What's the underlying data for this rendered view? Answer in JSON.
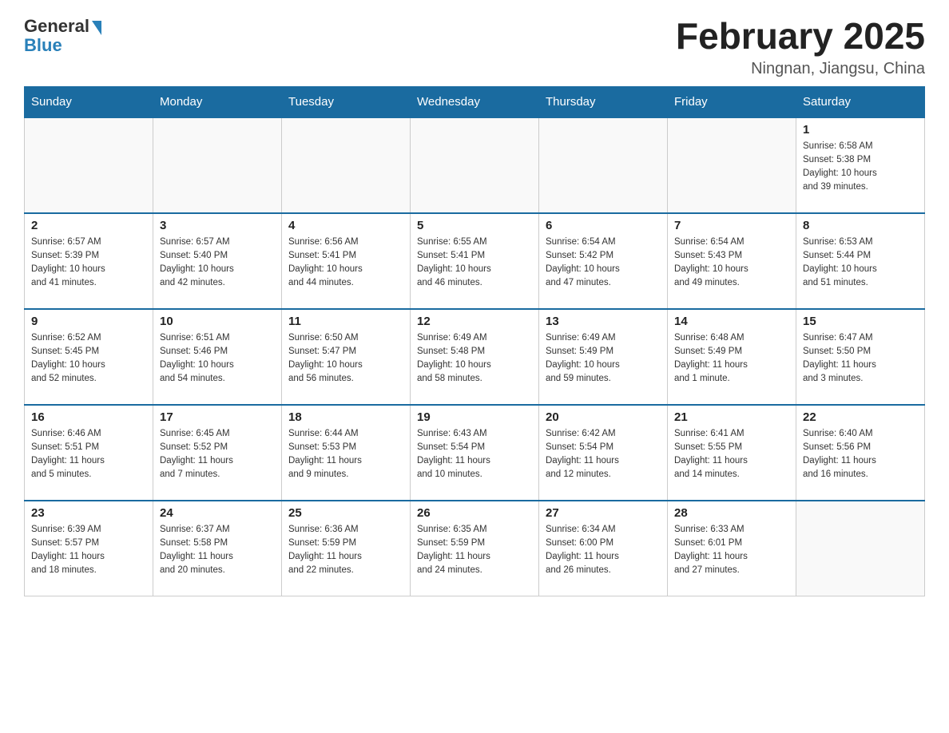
{
  "header": {
    "logo_general": "General",
    "logo_blue": "Blue",
    "month_title": "February 2025",
    "location": "Ningnan, Jiangsu, China"
  },
  "days_of_week": [
    "Sunday",
    "Monday",
    "Tuesday",
    "Wednesday",
    "Thursday",
    "Friday",
    "Saturday"
  ],
  "weeks": [
    [
      {
        "day": "",
        "info": ""
      },
      {
        "day": "",
        "info": ""
      },
      {
        "day": "",
        "info": ""
      },
      {
        "day": "",
        "info": ""
      },
      {
        "day": "",
        "info": ""
      },
      {
        "day": "",
        "info": ""
      },
      {
        "day": "1",
        "info": "Sunrise: 6:58 AM\nSunset: 5:38 PM\nDaylight: 10 hours\nand 39 minutes."
      }
    ],
    [
      {
        "day": "2",
        "info": "Sunrise: 6:57 AM\nSunset: 5:39 PM\nDaylight: 10 hours\nand 41 minutes."
      },
      {
        "day": "3",
        "info": "Sunrise: 6:57 AM\nSunset: 5:40 PM\nDaylight: 10 hours\nand 42 minutes."
      },
      {
        "day": "4",
        "info": "Sunrise: 6:56 AM\nSunset: 5:41 PM\nDaylight: 10 hours\nand 44 minutes."
      },
      {
        "day": "5",
        "info": "Sunrise: 6:55 AM\nSunset: 5:41 PM\nDaylight: 10 hours\nand 46 minutes."
      },
      {
        "day": "6",
        "info": "Sunrise: 6:54 AM\nSunset: 5:42 PM\nDaylight: 10 hours\nand 47 minutes."
      },
      {
        "day": "7",
        "info": "Sunrise: 6:54 AM\nSunset: 5:43 PM\nDaylight: 10 hours\nand 49 minutes."
      },
      {
        "day": "8",
        "info": "Sunrise: 6:53 AM\nSunset: 5:44 PM\nDaylight: 10 hours\nand 51 minutes."
      }
    ],
    [
      {
        "day": "9",
        "info": "Sunrise: 6:52 AM\nSunset: 5:45 PM\nDaylight: 10 hours\nand 52 minutes."
      },
      {
        "day": "10",
        "info": "Sunrise: 6:51 AM\nSunset: 5:46 PM\nDaylight: 10 hours\nand 54 minutes."
      },
      {
        "day": "11",
        "info": "Sunrise: 6:50 AM\nSunset: 5:47 PM\nDaylight: 10 hours\nand 56 minutes."
      },
      {
        "day": "12",
        "info": "Sunrise: 6:49 AM\nSunset: 5:48 PM\nDaylight: 10 hours\nand 58 minutes."
      },
      {
        "day": "13",
        "info": "Sunrise: 6:49 AM\nSunset: 5:49 PM\nDaylight: 10 hours\nand 59 minutes."
      },
      {
        "day": "14",
        "info": "Sunrise: 6:48 AM\nSunset: 5:49 PM\nDaylight: 11 hours\nand 1 minute."
      },
      {
        "day": "15",
        "info": "Sunrise: 6:47 AM\nSunset: 5:50 PM\nDaylight: 11 hours\nand 3 minutes."
      }
    ],
    [
      {
        "day": "16",
        "info": "Sunrise: 6:46 AM\nSunset: 5:51 PM\nDaylight: 11 hours\nand 5 minutes."
      },
      {
        "day": "17",
        "info": "Sunrise: 6:45 AM\nSunset: 5:52 PM\nDaylight: 11 hours\nand 7 minutes."
      },
      {
        "day": "18",
        "info": "Sunrise: 6:44 AM\nSunset: 5:53 PM\nDaylight: 11 hours\nand 9 minutes."
      },
      {
        "day": "19",
        "info": "Sunrise: 6:43 AM\nSunset: 5:54 PM\nDaylight: 11 hours\nand 10 minutes."
      },
      {
        "day": "20",
        "info": "Sunrise: 6:42 AM\nSunset: 5:54 PM\nDaylight: 11 hours\nand 12 minutes."
      },
      {
        "day": "21",
        "info": "Sunrise: 6:41 AM\nSunset: 5:55 PM\nDaylight: 11 hours\nand 14 minutes."
      },
      {
        "day": "22",
        "info": "Sunrise: 6:40 AM\nSunset: 5:56 PM\nDaylight: 11 hours\nand 16 minutes."
      }
    ],
    [
      {
        "day": "23",
        "info": "Sunrise: 6:39 AM\nSunset: 5:57 PM\nDaylight: 11 hours\nand 18 minutes."
      },
      {
        "day": "24",
        "info": "Sunrise: 6:37 AM\nSunset: 5:58 PM\nDaylight: 11 hours\nand 20 minutes."
      },
      {
        "day": "25",
        "info": "Sunrise: 6:36 AM\nSunset: 5:59 PM\nDaylight: 11 hours\nand 22 minutes."
      },
      {
        "day": "26",
        "info": "Sunrise: 6:35 AM\nSunset: 5:59 PM\nDaylight: 11 hours\nand 24 minutes."
      },
      {
        "day": "27",
        "info": "Sunrise: 6:34 AM\nSunset: 6:00 PM\nDaylight: 11 hours\nand 26 minutes."
      },
      {
        "day": "28",
        "info": "Sunrise: 6:33 AM\nSunset: 6:01 PM\nDaylight: 11 hours\nand 27 minutes."
      },
      {
        "day": "",
        "info": ""
      }
    ]
  ]
}
